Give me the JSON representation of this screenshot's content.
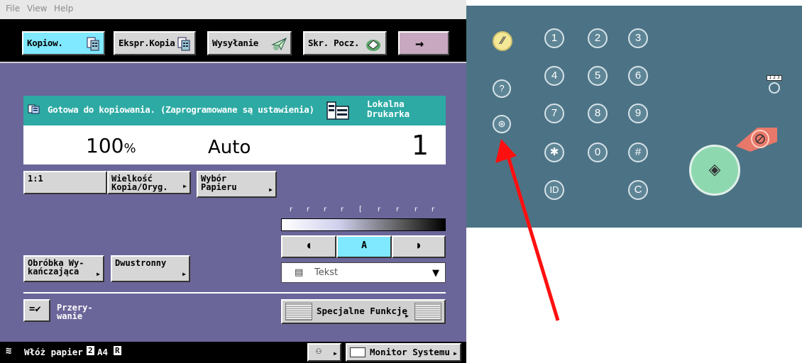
{
  "menu": [
    "File",
    "View",
    "Help"
  ],
  "tabs": [
    {
      "label": "Kopiow.",
      "active": true
    },
    {
      "label": "Ekspr.Kopia",
      "active": false
    },
    {
      "label": "Wysyłanie",
      "active": false
    },
    {
      "label": "Skr. Pocz.",
      "active": false
    }
  ],
  "tab_arrow": "→",
  "status": {
    "message": "Gotowa do kopiowania. (Zaprogramowane są ustawienia)",
    "location_line1": "Lokalna",
    "location_line2": "Drukarka"
  },
  "values": {
    "zoom": "100",
    "zoom_unit": "%",
    "paper": "Auto",
    "copies": "1"
  },
  "buttons": {
    "ratio": "1:1",
    "size": "Wielkość\nKopia/Oryg.",
    "paper_select": "Wybór\nPapieru",
    "finishing": "Obróbka Wy-\nkańczająca",
    "duplex": "Dwustronny",
    "interrupt": "Przery-\nwanie",
    "special": "Specjalne Funkcje",
    "system_monitor": "Monitor Systemu"
  },
  "density": {
    "lighter": "◖",
    "auto": "A",
    "darker": "◗",
    "scale_marks": 9
  },
  "original_type": {
    "value": "Tekst"
  },
  "bottom": {
    "paper_msg": "Włóż papier",
    "tray": "2",
    "paper_size": "A4",
    "orientation": "R"
  },
  "keypad": {
    "keys": [
      "1",
      "2",
      "3",
      "4",
      "5",
      "6",
      "7",
      "8",
      "9",
      "✱",
      "0",
      "#"
    ],
    "id": "ID",
    "clear": "C",
    "help": "?",
    "counter": "1 2 3"
  },
  "colors": {
    "screen_bg": "#6b6699",
    "status_bar": "#2eaaa4",
    "active_tab": "#80e8ff",
    "panel_bg": "#4c7385",
    "start_key": "#8ed8b0",
    "stop_key": "#e8786a",
    "reset_key": "#f4e896",
    "annotation_arrow": "#ff1010"
  }
}
